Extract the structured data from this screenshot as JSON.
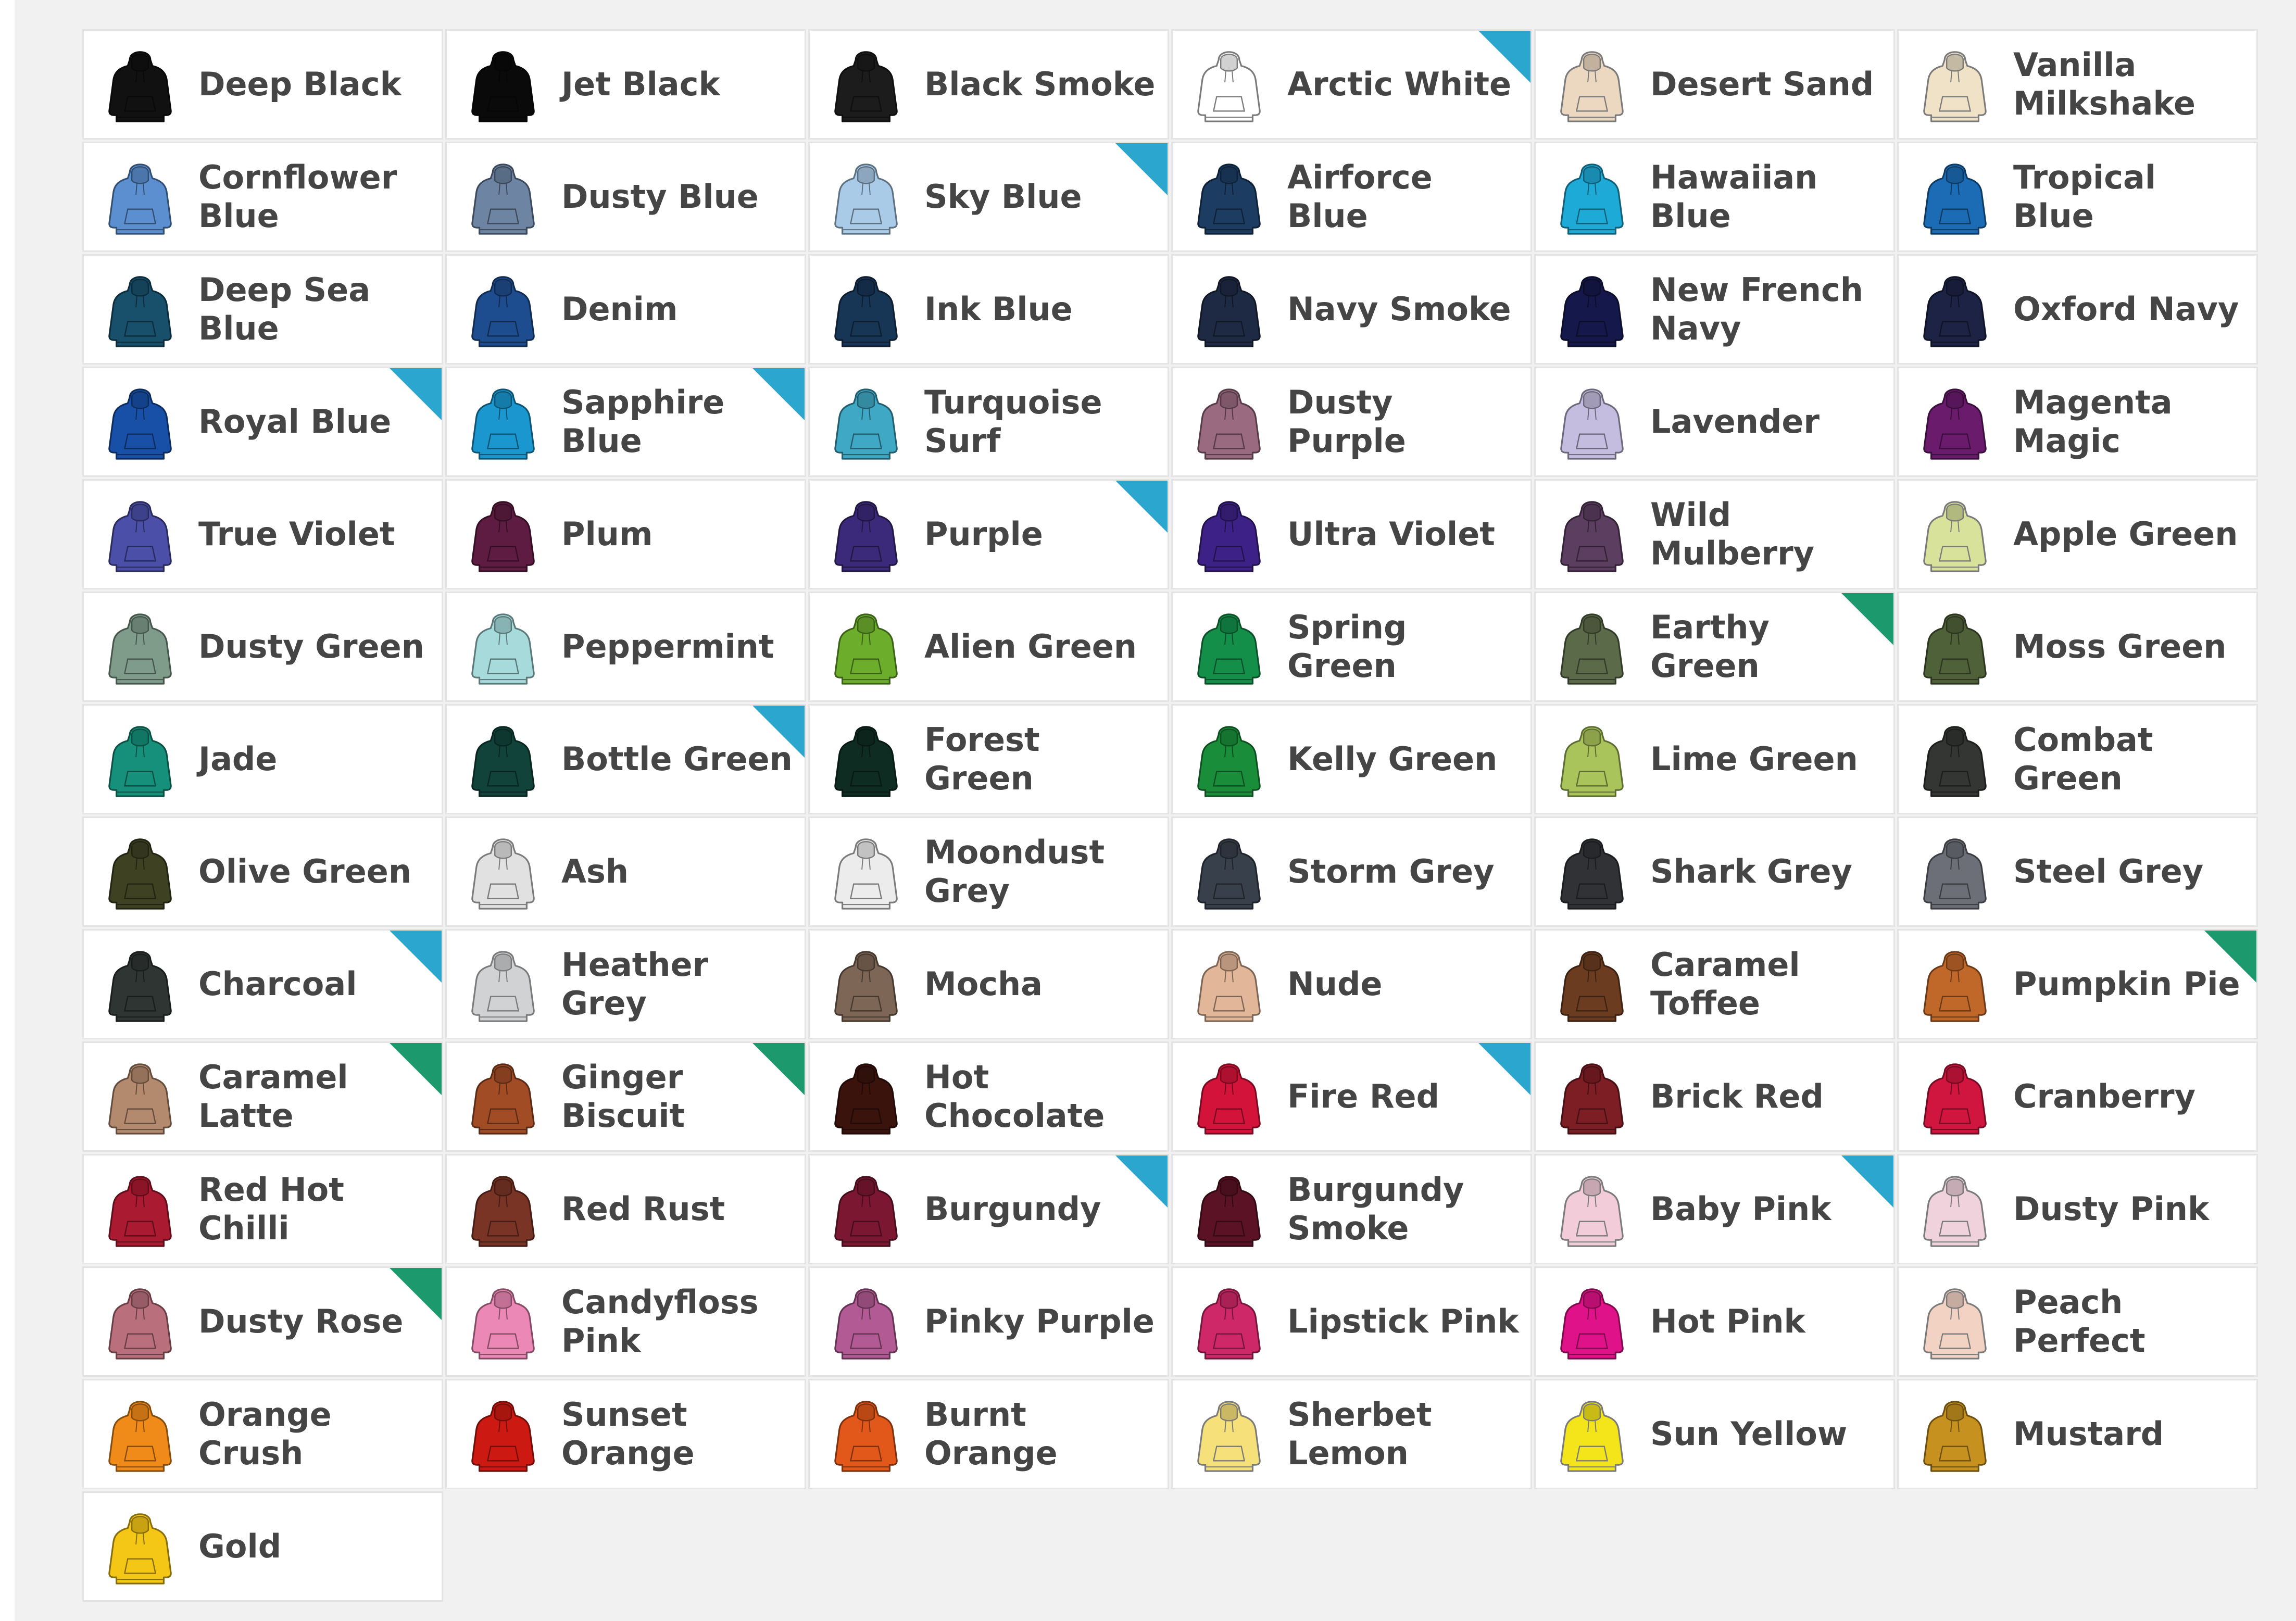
{
  "colour_options": [
    {
      "name": "Deep Black",
      "hex": "#111111"
    },
    {
      "name": "Jet Black",
      "hex": "#0a0a0a"
    },
    {
      "name": "Black Smoke",
      "hex": "#1c1c1c"
    },
    {
      "name": "Arctic White",
      "hex": "#ffffff",
      "badge": "blue"
    },
    {
      "name": "Desert Sand",
      "hex": "#ecd8c0"
    },
    {
      "name": "Vanilla Milkshake",
      "hex": "#efe2c6"
    },
    {
      "name": "Cornflower Blue",
      "hex": "#5b8fd0"
    },
    {
      "name": "Dusty Blue",
      "hex": "#6d84a3"
    },
    {
      "name": "Sky Blue",
      "hex": "#a9cbe8",
      "badge": "blue"
    },
    {
      "name": "Airforce Blue",
      "hex": "#1c3c62"
    },
    {
      "name": "Hawaiian Blue",
      "hex": "#1eaad6"
    },
    {
      "name": "Tropical Blue",
      "hex": "#1b6cb4"
    },
    {
      "name": "Deep Sea Blue",
      "hex": "#18506c"
    },
    {
      "name": "Denim",
      "hex": "#1e4d8f"
    },
    {
      "name": "Ink Blue",
      "hex": "#173555"
    },
    {
      "name": "Navy Smoke",
      "hex": "#1e2a44"
    },
    {
      "name": "New French Navy",
      "hex": "#15184a"
    },
    {
      "name": "Oxford Navy",
      "hex": "#1c2344"
    },
    {
      "name": "Royal Blue",
      "hex": "#1850a8",
      "badge": "blue"
    },
    {
      "name": "Sapphire Blue",
      "hex": "#1a97cf",
      "badge": "blue"
    },
    {
      "name": "Turquoise Surf",
      "hex": "#3fa8c4"
    },
    {
      "name": "Dusty Purple",
      "hex": "#9a6b80"
    },
    {
      "name": "Lavender",
      "hex": "#c5bde0"
    },
    {
      "name": "Magenta Magic",
      "hex": "#6a1b6c"
    },
    {
      "name": "True Violet",
      "hex": "#4b4fa7"
    },
    {
      "name": "Plum",
      "hex": "#5e1c42"
    },
    {
      "name": "Purple",
      "hex": "#3b2a7a",
      "badge": "blue"
    },
    {
      "name": "Ultra Violet",
      "hex": "#3e2186"
    },
    {
      "name": "Wild Mulberry",
      "hex": "#5c3e60"
    },
    {
      "name": "Apple Green",
      "hex": "#d9e29a"
    },
    {
      "name": "Dusty Green",
      "hex": "#7f9c8a"
    },
    {
      "name": "Peppermint",
      "hex": "#a6dadb"
    },
    {
      "name": "Alien Green",
      "hex": "#6cae2c"
    },
    {
      "name": "Spring Green",
      "hex": "#148f4a"
    },
    {
      "name": "Earthy Green",
      "hex": "#5b6a48",
      "badge": "green"
    },
    {
      "name": "Moss Green",
      "hex": "#4f6139"
    },
    {
      "name": "Jade",
      "hex": "#16907a"
    },
    {
      "name": "Bottle Green",
      "hex": "#11433a",
      "badge": "blue"
    },
    {
      "name": "Forest Green",
      "hex": "#0f2c22"
    },
    {
      "name": "Kelly Green",
      "hex": "#1a8d3a"
    },
    {
      "name": "Lime Green",
      "hex": "#a9c45a"
    },
    {
      "name": "Combat Green",
      "hex": "#333633"
    },
    {
      "name": "Olive Green",
      "hex": "#3e4222"
    },
    {
      "name": "Ash",
      "hex": "#e1e1e1"
    },
    {
      "name": "Moondust Grey",
      "hex": "#ececec"
    },
    {
      "name": "Storm Grey",
      "hex": "#38404c"
    },
    {
      "name": "Shark Grey",
      "hex": "#303236"
    },
    {
      "name": "Steel Grey",
      "hex": "#6d6f78"
    },
    {
      "name": "Charcoal",
      "hex": "#2f3532",
      "badge": "blue"
    },
    {
      "name": "Heather Grey",
      "hex": "#d1d2d4"
    },
    {
      "name": "Mocha",
      "hex": "#7d6656"
    },
    {
      "name": "Nude",
      "hex": "#e2b698"
    },
    {
      "name": "Caramel Toffee",
      "hex": "#6b3c20"
    },
    {
      "name": "Pumpkin Pie",
      "hex": "#c0672a",
      "badge": "green"
    },
    {
      "name": "Caramel Latte",
      "hex": "#b48a6e",
      "badge": "green"
    },
    {
      "name": "Ginger Biscuit",
      "hex": "#a24c26",
      "badge": "green"
    },
    {
      "name": "Hot Chocolate",
      "hex": "#3a130d"
    },
    {
      "name": "Fire Red",
      "hex": "#d4133a",
      "badge": "blue"
    },
    {
      "name": "Brick Red",
      "hex": "#7d1d24"
    },
    {
      "name": "Cranberry",
      "hex": "#d0153e"
    },
    {
      "name": "Red Hot Chilli",
      "hex": "#aa1a30"
    },
    {
      "name": "Red Rust",
      "hex": "#7a3426"
    },
    {
      "name": "Burgundy",
      "hex": "#7c1732",
      "badge": "blue"
    },
    {
      "name": "Burgundy Smoke",
      "hex": "#5a1224"
    },
    {
      "name": "Baby Pink",
      "hex": "#f2ccd8",
      "badge": "blue"
    },
    {
      "name": "Dusty Pink",
      "hex": "#f0d2dc"
    },
    {
      "name": "Dusty Rose",
      "hex": "#b9707c",
      "badge": "green"
    },
    {
      "name": "Candyfloss Pink",
      "hex": "#ec88b6"
    },
    {
      "name": "Pinky Purple",
      "hex": "#b25a94"
    },
    {
      "name": "Lipstick Pink",
      "hex": "#cf2869"
    },
    {
      "name": "Hot Pink",
      "hex": "#e01289"
    },
    {
      "name": "Peach Perfect",
      "hex": "#f1d2c3"
    },
    {
      "name": "Orange Crush",
      "hex": "#f08a18"
    },
    {
      "name": "Sunset Orange",
      "hex": "#cc1a12"
    },
    {
      "name": "Burnt Orange",
      "hex": "#e2581a"
    },
    {
      "name": "Sherbet Lemon",
      "hex": "#f6e07a"
    },
    {
      "name": "Sun Yellow",
      "hex": "#f4e41a"
    },
    {
      "name": "Mustard",
      "hex": "#c6911e"
    },
    {
      "name": "Gold",
      "hex": "#f4c616"
    }
  ],
  "badge_colors": {
    "blue": "#2aa6cf",
    "green": "#1c9a6d"
  },
  "icon_outline": "#7a7a7a",
  "icon_name": "hoodie-icon"
}
